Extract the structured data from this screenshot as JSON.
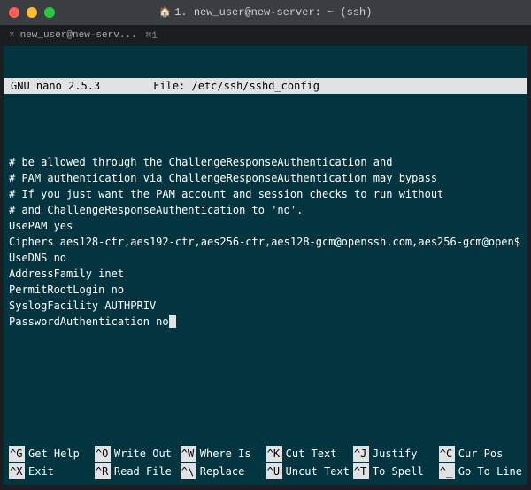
{
  "window": {
    "title": "1. new_user@new-server: ~ (ssh)"
  },
  "tab": {
    "label": "new_user@new-serv...",
    "shortcut": "⌘1"
  },
  "nano": {
    "version": "GNU nano 2.5.3",
    "file_label": "File: /etc/ssh/sshd_config"
  },
  "file_lines": [
    "# be allowed through the ChallengeResponseAuthentication and",
    "# PAM authentication via ChallengeResponseAuthentication may bypass",
    "# If you just want the PAM account and session checks to run without",
    "# and ChallengeResponseAuthentication to 'no'.",
    "UsePAM yes",
    "Ciphers aes128-ctr,aes192-ctr,aes256-ctr,aes128-gcm@openssh.com,aes256-gcm@open$",
    "UseDNS no",
    "AddressFamily inet",
    "PermitRootLogin no",
    "SyslogFacility AUTHPRIV",
    "PasswordAuthentication no"
  ],
  "shortcuts": [
    {
      "key": "^G",
      "label": "Get Help"
    },
    {
      "key": "^O",
      "label": "Write Out"
    },
    {
      "key": "^W",
      "label": "Where Is"
    },
    {
      "key": "^K",
      "label": "Cut Text"
    },
    {
      "key": "^J",
      "label": "Justify"
    },
    {
      "key": "^C",
      "label": "Cur Pos"
    },
    {
      "key": "^X",
      "label": "Exit"
    },
    {
      "key": "^R",
      "label": "Read File"
    },
    {
      "key": "^\\",
      "label": "Replace"
    },
    {
      "key": "^U",
      "label": "Uncut Text"
    },
    {
      "key": "^T",
      "label": "To Spell"
    },
    {
      "key": "^_",
      "label": "Go To Line"
    }
  ]
}
